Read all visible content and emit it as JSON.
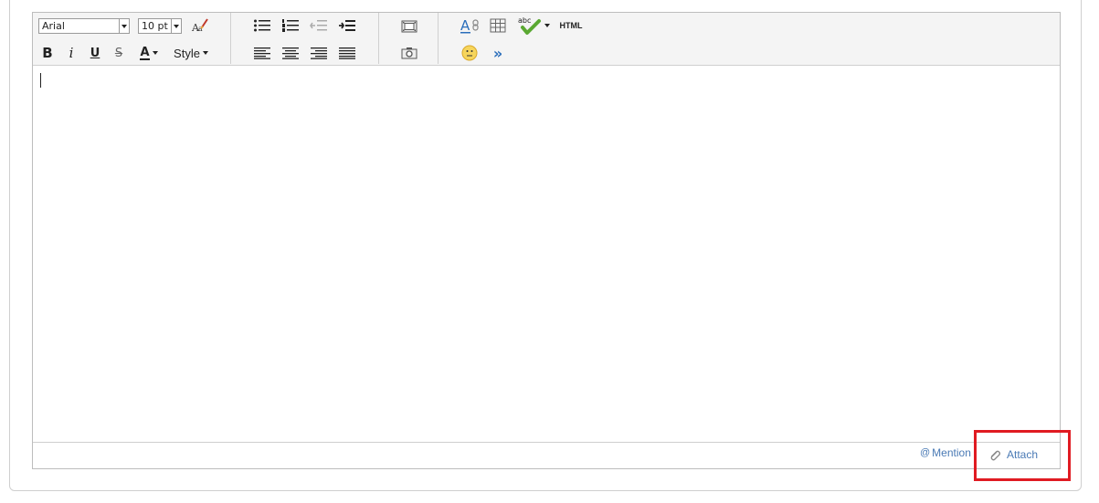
{
  "toolbar": {
    "font_family": "Arial",
    "font_size": "10 pt",
    "bold": "B",
    "italic": "i",
    "underline": "U",
    "strike": "S",
    "font_color": "A",
    "style_label": "Style",
    "html_label": "HTML",
    "spell_label": "abc",
    "forward_label": "»"
  },
  "footer": {
    "mention_at": "@",
    "mention_label": "Mention",
    "attach_label": "Attach"
  },
  "colors": {
    "link": "#4a7ab5",
    "highlight": "#e01b22",
    "spell_check": "#5aa832"
  }
}
